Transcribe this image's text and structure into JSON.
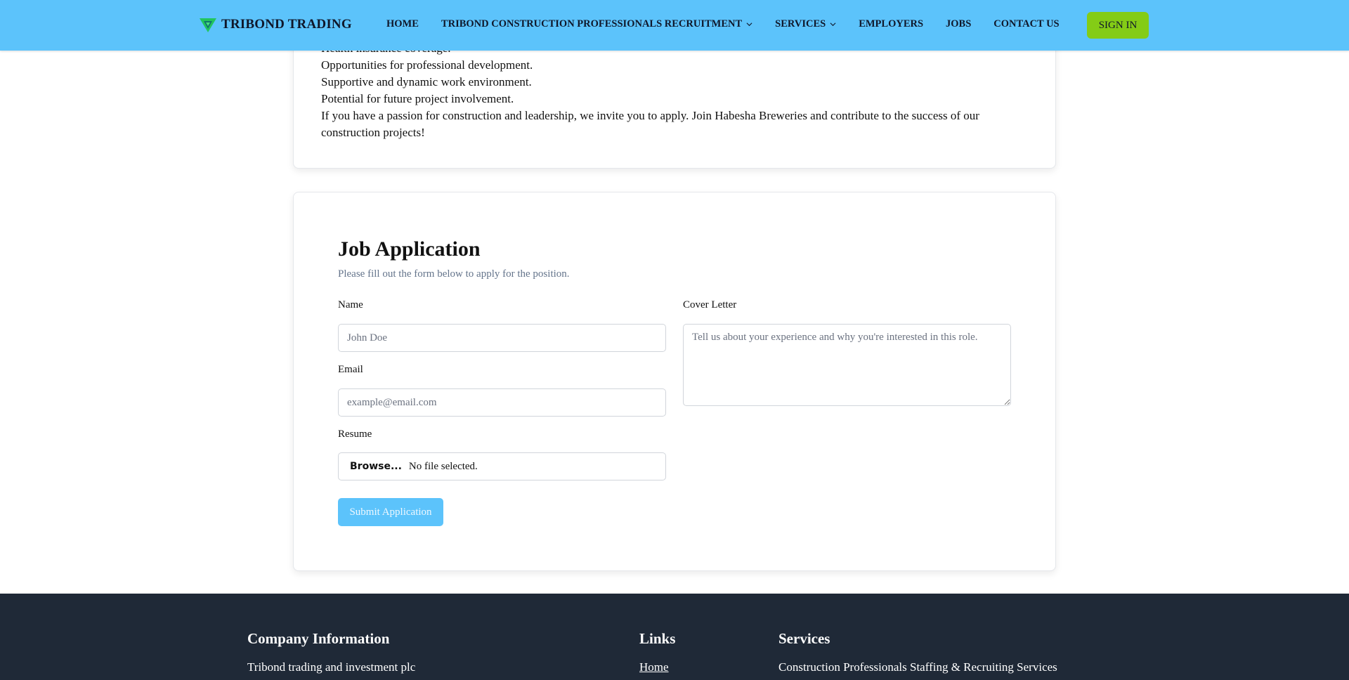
{
  "brand": {
    "name": "TRIBOND TRADING",
    "logo_icon": "triangle-logo-icon",
    "logo_color": "#22c55e"
  },
  "nav": {
    "links": [
      {
        "label": "HOME",
        "dropdown": false
      },
      {
        "label": "TRIBOND CONSTRUCTION PROFESSIONALS RECRUITMENT",
        "dropdown": true
      },
      {
        "label": "SERVICES",
        "dropdown": true
      },
      {
        "label": "EMPLOYERS",
        "dropdown": false
      },
      {
        "label": "JOBS",
        "dropdown": false
      },
      {
        "label": "CONTACT US",
        "dropdown": false
      }
    ],
    "signin_label": "SIGN IN",
    "bar_color": "#5cc3fb",
    "signin_color": "#84cc16"
  },
  "job_description": {
    "lines": [
      "Health insurance coverage.",
      "Opportunities for professional development.",
      "Supportive and dynamic work environment.",
      "Potential for future project involvement.",
      "If you have a passion for construction and leadership, we invite you to apply. Join Habesha Breweries and contribute to the success of our construction projects!"
    ]
  },
  "application_form": {
    "title": "Job Application",
    "subtitle": "Please fill out the form below to apply for the position.",
    "name_label": "Name",
    "name_placeholder": "John Doe",
    "email_label": "Email",
    "email_placeholder": "example@email.com",
    "resume_label": "Resume",
    "browse_label": "Browse...",
    "file_status": "No file selected.",
    "cover_letter_label": "Cover Letter",
    "cover_letter_placeholder": "Tell us about your experience and why you're interested in this role.",
    "submit_label": "Submit Application"
  },
  "footer": {
    "company_heading": "Company Information",
    "company_name": "Tribond trading and investment plc",
    "links_heading": "Links",
    "links": [
      "Home"
    ],
    "services_heading": "Services",
    "services": [
      "Construction Professionals Staffing & Recruiting Services"
    ],
    "background_color": "#1f2937"
  }
}
